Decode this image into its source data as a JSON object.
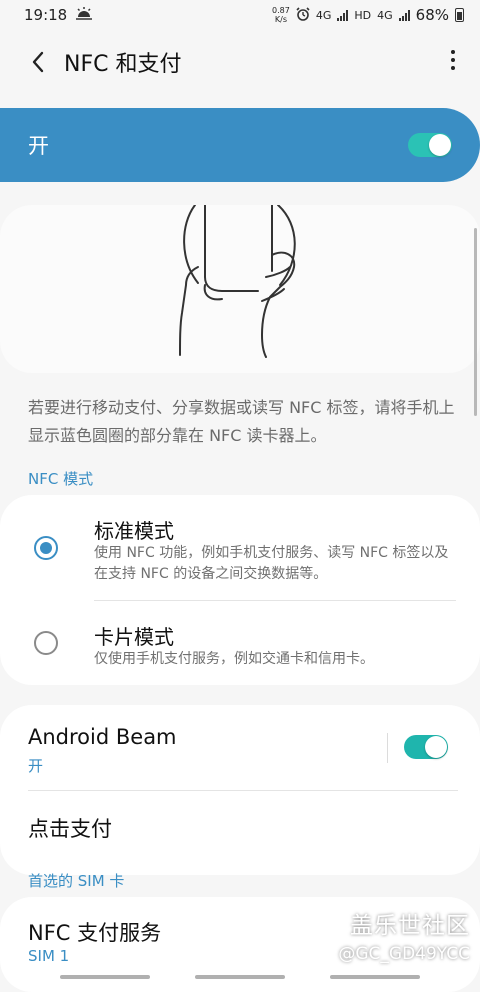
{
  "status": {
    "time": "19:18",
    "netspeed_value": "0.87",
    "netspeed_unit": "K/s",
    "network1": "4G",
    "hd": "HD",
    "network2": "4G",
    "battery": "68%"
  },
  "header": {
    "title": "NFC 和支付"
  },
  "master": {
    "label": "开",
    "enabled": true
  },
  "description": "若要进行移动支付、分享数据或读写 NFC 标签，请将手机上显示蓝色圆圈的部分靠在 NFC 读卡器上。",
  "nfc_mode": {
    "section_label": "NFC 模式",
    "options": [
      {
        "title": "标准模式",
        "subtitle": "使用 NFC 功能，例如手机支付服务、读写 NFC 标签以及在支持 NFC 的设备之间交换数据等。",
        "selected": true
      },
      {
        "title": "卡片模式",
        "subtitle": "仅使用手机支付服务，例如交通卡和信用卡。",
        "selected": false
      }
    ]
  },
  "beam": {
    "title": "Android Beam",
    "status": "开",
    "enabled": true
  },
  "tap_pay": {
    "title": "点击支付"
  },
  "sim_section": {
    "label": "首选的 SIM 卡"
  },
  "pay_service": {
    "title": "NFC 支付服务",
    "value": "SIM 1"
  },
  "watermark": {
    "line1": "盖乐世社区",
    "line2": "@GC_GD49YCC"
  },
  "colors": {
    "accent": "#3a8ec4",
    "toggle": "#1fb5ad",
    "background": "#f6f6f6"
  }
}
